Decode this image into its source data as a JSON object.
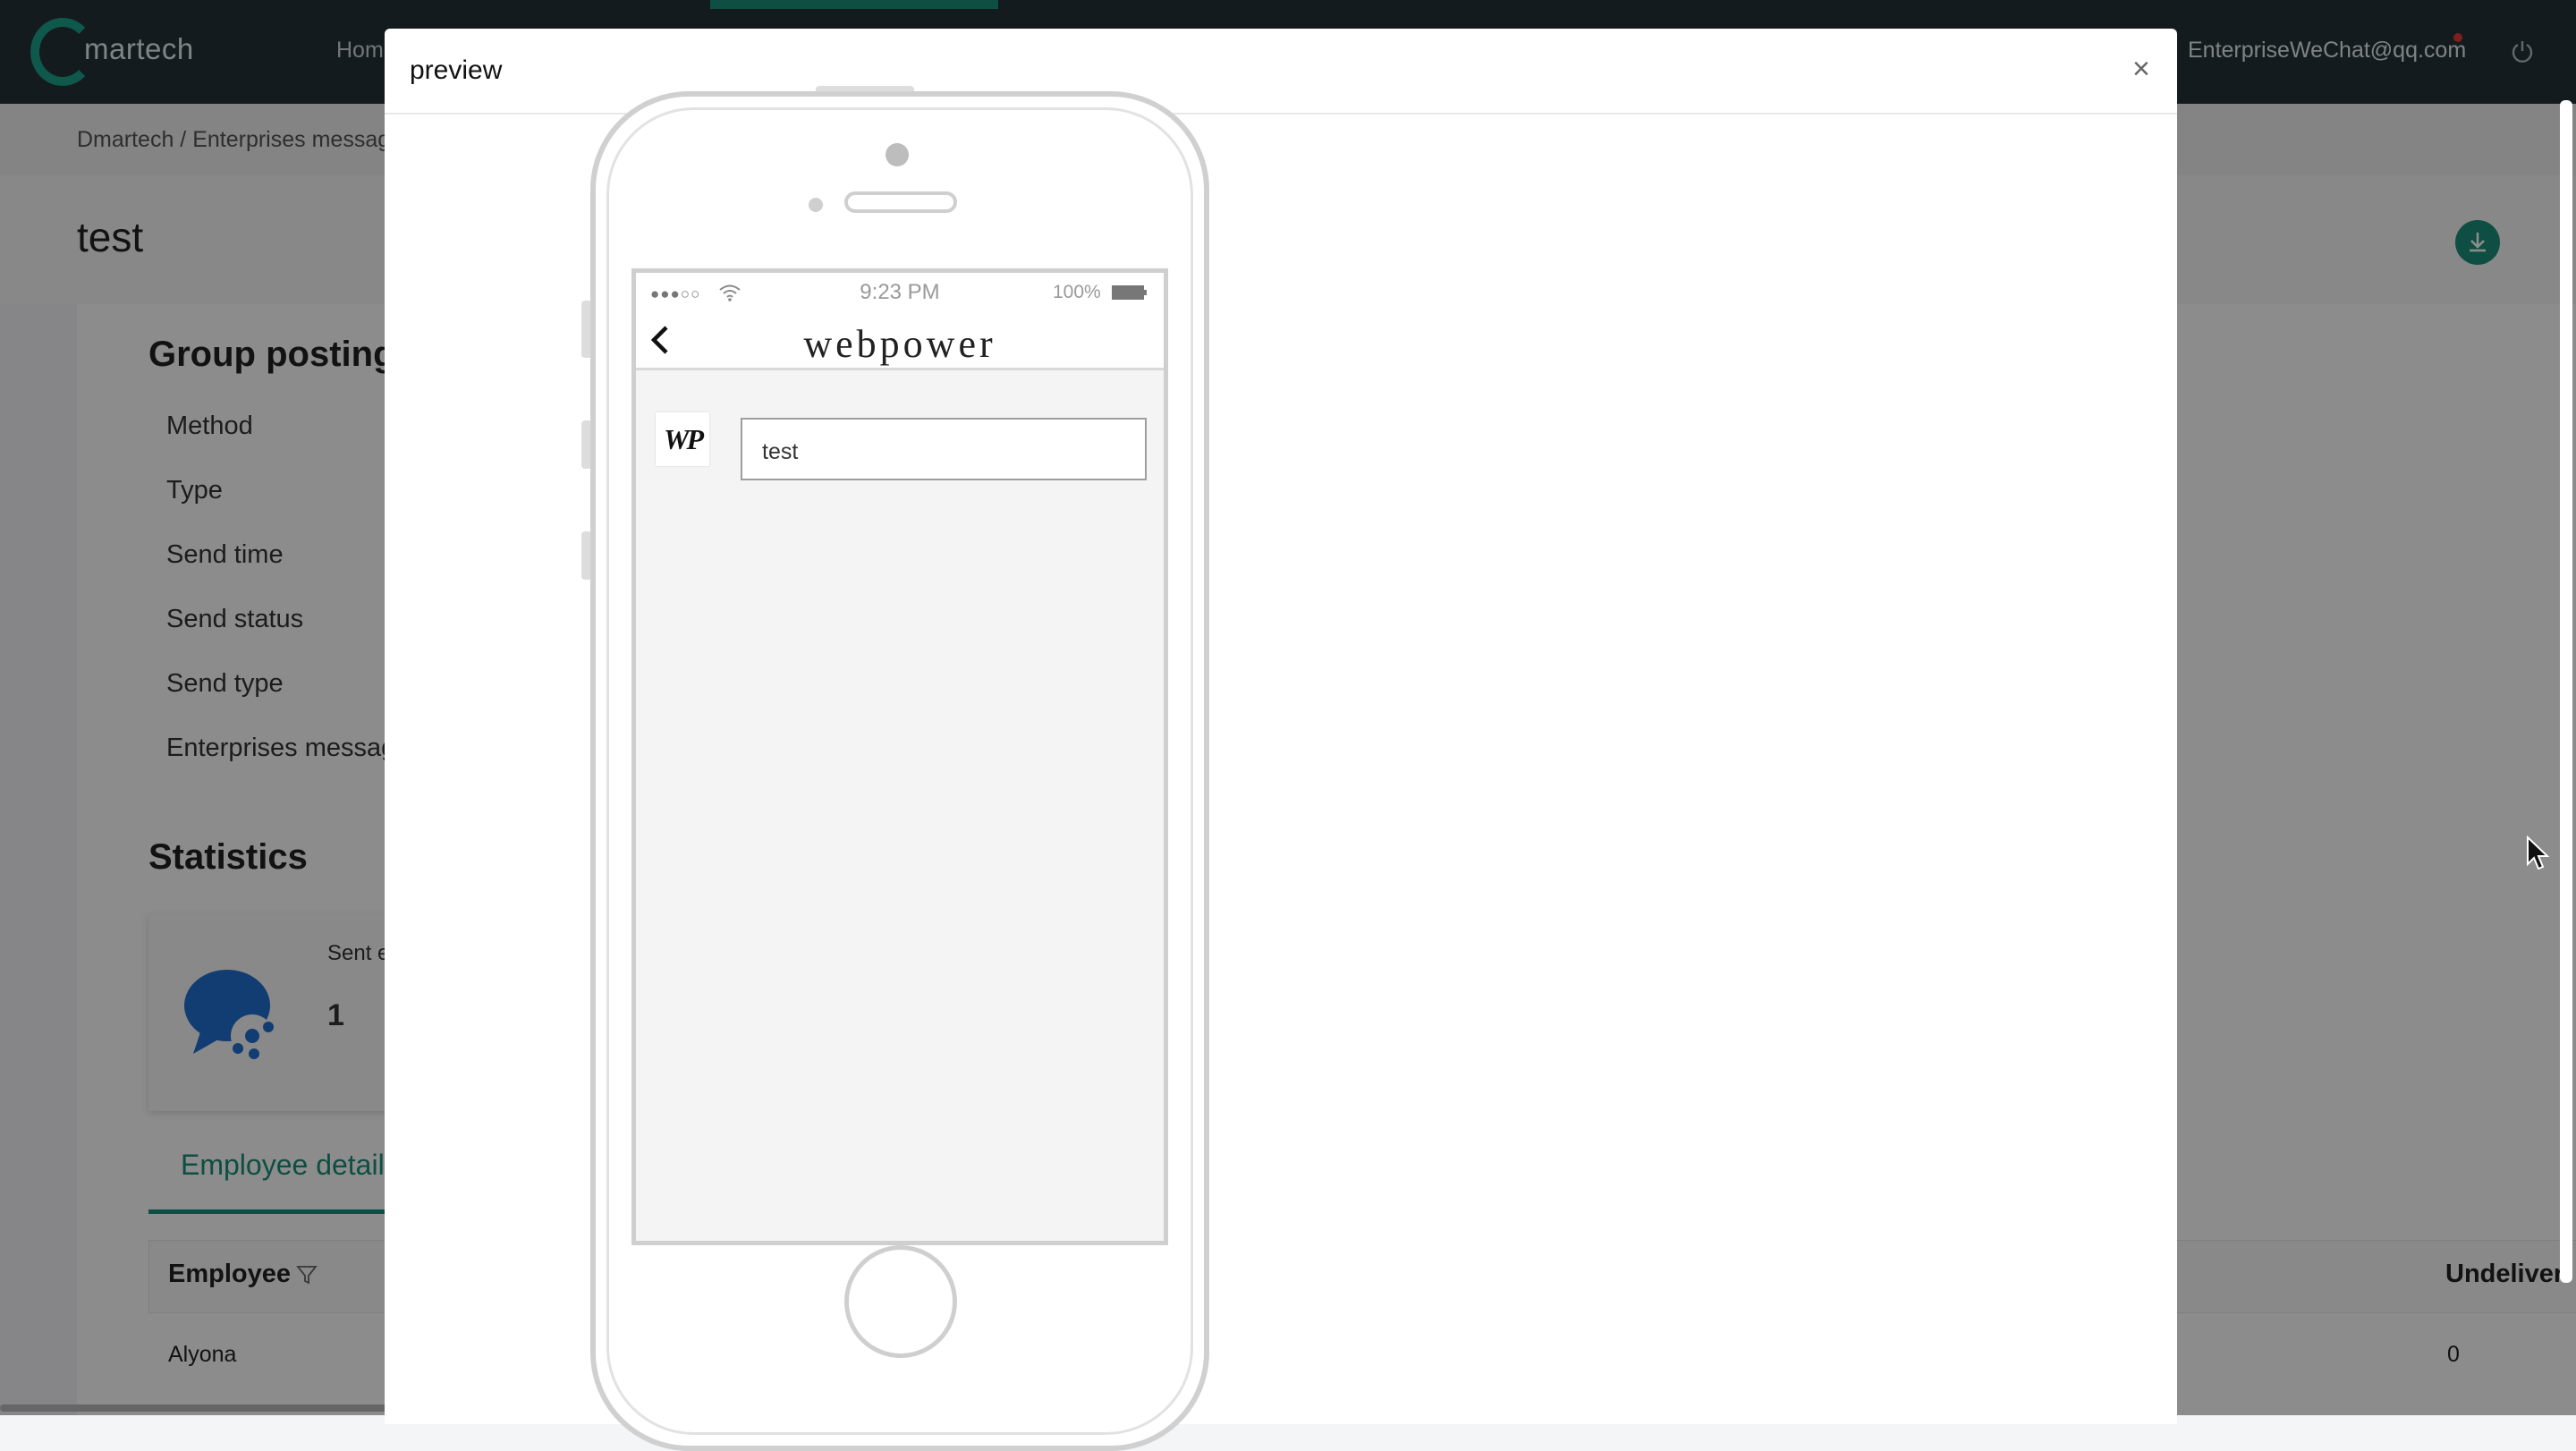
{
  "app": {
    "logo_text": "martech",
    "nav_home": "Hom",
    "user_email": "EnterpriseWeChat@qq.com"
  },
  "page": {
    "breadcrumb": "Dmartech / Enterprises messag",
    "title": "test",
    "group_posting_heading": "Group posting",
    "fields": {
      "method": "Method",
      "type": "Type",
      "send_time": "Send time",
      "send_status": "Send status",
      "send_type": "Send type",
      "enterprises_message": "Enterprises messag"
    },
    "statistics_heading": "Statistics",
    "stat_label": "Sent e",
    "stat_value": "1",
    "tab_employee": "Employee detail",
    "table": {
      "col_employee": "Employee",
      "col_undelivered": "Undeliver",
      "rows": [
        {
          "employee": "Alyona",
          "undelivered": "0"
        }
      ]
    }
  },
  "modal": {
    "title": "preview",
    "close_glyph": "×",
    "phone": {
      "signal": "●●●○○",
      "time": "9:23 PM",
      "battery": "100%",
      "brand": "webpower",
      "avatar_text": "WP",
      "message": "test"
    }
  },
  "colors": {
    "topbar": "#263238",
    "accent": "#1a8f7a",
    "mask": "rgba(0,0,0,0.45)"
  },
  "icons": [
    "power-icon",
    "download-icon",
    "filter-icon",
    "close-icon",
    "wifi-icon",
    "battery-icon",
    "back-chevron-icon",
    "mouse-cursor-icon"
  ]
}
